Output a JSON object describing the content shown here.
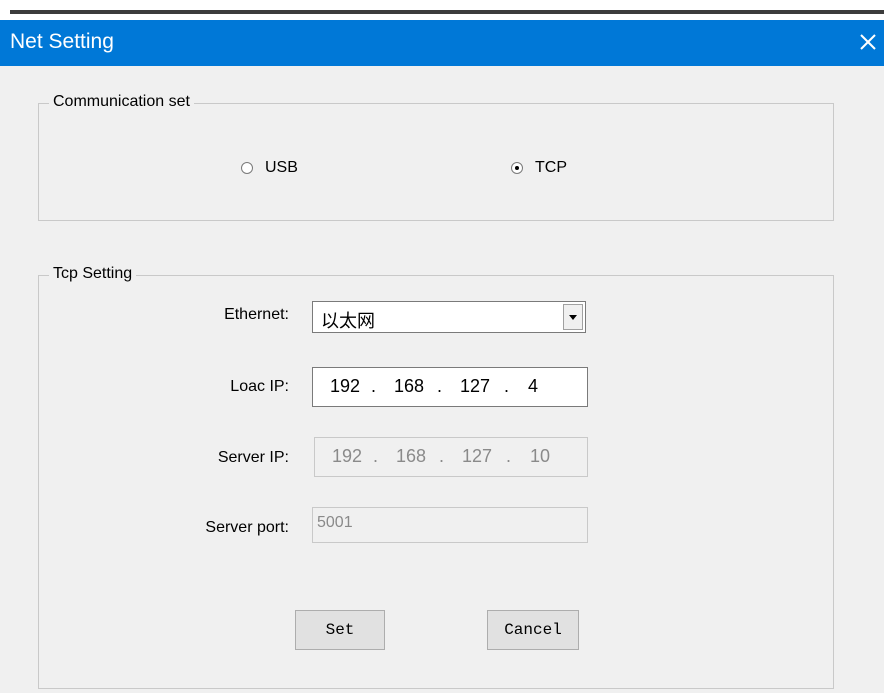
{
  "window": {
    "title": "Net Setting",
    "close_icon": "close-icon"
  },
  "communication": {
    "legend": "Communication set",
    "options": [
      {
        "label": "USB",
        "checked": false
      },
      {
        "label": "TCP",
        "checked": true
      }
    ]
  },
  "tcp": {
    "legend": "Tcp Setting",
    "ethernet": {
      "label": "Ethernet:",
      "value": "以太网"
    },
    "local_ip": {
      "label": "Loac IP:",
      "octets": [
        "192",
        "168",
        "127",
        "4"
      ]
    },
    "server_ip": {
      "label": "Server IP:",
      "octets": [
        "192",
        "168",
        "127",
        "10"
      ]
    },
    "server_port": {
      "label": "Server port:",
      "value": "5001"
    }
  },
  "buttons": {
    "set": "Set",
    "cancel": "Cancel"
  },
  "colors": {
    "titlebar": "#0078d7",
    "background": "#f0f0f0"
  }
}
